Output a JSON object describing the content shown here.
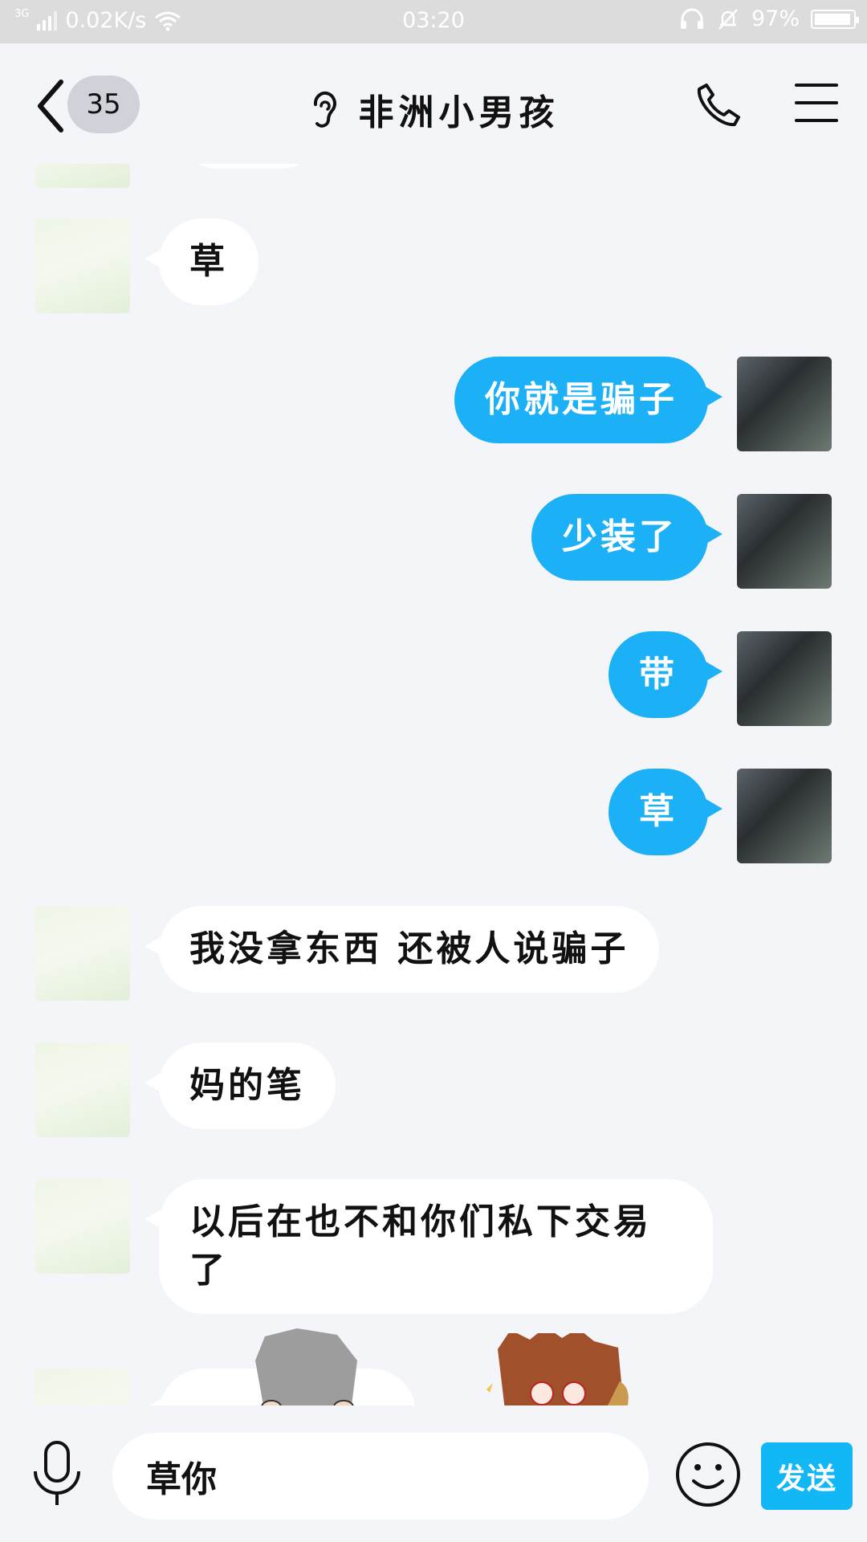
{
  "status_bar": {
    "network_type": "3G",
    "net_speed": "0.02K/s",
    "time": "03:20",
    "battery": "97%"
  },
  "header": {
    "unread_count": "35",
    "title": "非洲小男孩"
  },
  "messages": [
    {
      "side": "in",
      "text": "草"
    },
    {
      "side": "out",
      "text": "你就是骗子"
    },
    {
      "side": "out",
      "text": "少装了"
    },
    {
      "side": "out",
      "text": "带"
    },
    {
      "side": "out",
      "text": "草"
    },
    {
      "side": "in",
      "text": "我没拿东西 还被人说骗子"
    },
    {
      "side": "in",
      "text": "妈的笔"
    },
    {
      "side": "in",
      "text": "以后在也不和你们私下交易了"
    }
  ],
  "input": {
    "value": "草你",
    "send_label": "发送"
  },
  "colors": {
    "outgoing_bubble": "#1cb0f6",
    "send_button": "#12b7f5",
    "background": "#f3f5f9"
  }
}
